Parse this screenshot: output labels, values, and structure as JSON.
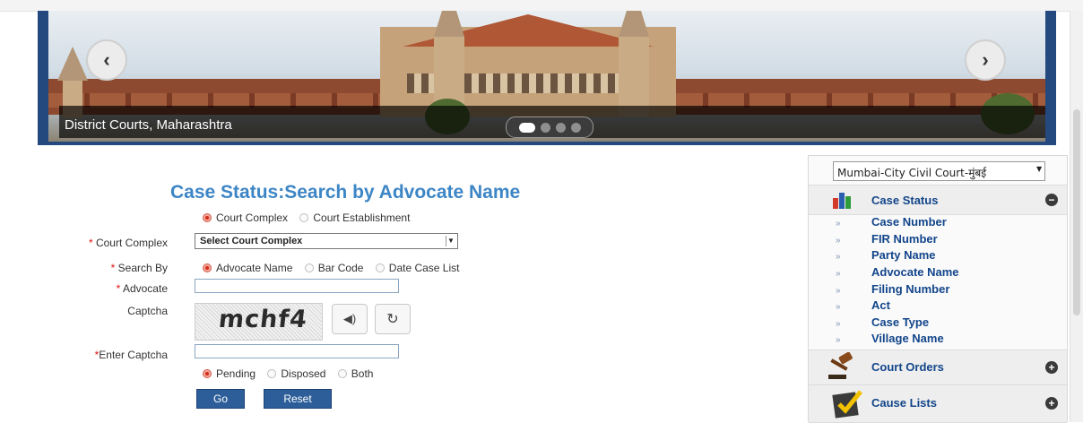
{
  "banner": {
    "caption": "District Courts, Maharashtra",
    "prev_icon": "chevron-left-icon",
    "next_icon": "chevron-right-icon",
    "slides": 4,
    "active_slide": 1
  },
  "form": {
    "title": "Case Status:Search by Advocate Name",
    "court_type_options": [
      "Court Complex",
      "Court Establishment"
    ],
    "court_type_selected": "Court Complex",
    "court_complex_label": "Court Complex",
    "court_complex_value": "Select Court Complex",
    "search_by_label": "Search By",
    "search_by_options": [
      "Advocate Name",
      "Bar Code",
      "Date Case List"
    ],
    "search_by_selected": "Advocate Name",
    "advocate_label": "Advocate",
    "advocate_value": "",
    "captcha_label": "Captcha",
    "captcha_text": "mchf4",
    "enter_captcha_label": "Enter Captcha",
    "enter_captcha_value": "",
    "status_options": [
      "Pending",
      "Disposed",
      "Both"
    ],
    "status_selected": "Pending",
    "go_label": "Go",
    "reset_label": "Reset"
  },
  "sidebar": {
    "district_select": "Mumbai-City Civil Court-मुंबई",
    "case_status": {
      "title": "Case Status",
      "expanded": true,
      "items": [
        "Case Number",
        "FIR Number",
        "Party Name",
        "Advocate Name",
        "Filing Number",
        "Act",
        "Case Type",
        "Village Name"
      ]
    },
    "court_orders": {
      "title": "Court Orders",
      "expanded": false
    },
    "cause_lists": {
      "title": "Cause Lists",
      "expanded": false
    }
  },
  "colors": {
    "title_blue": "#3d86c6",
    "link_blue": "#12458a",
    "button_blue": "#2d5e99",
    "banner_frame": "#24497e",
    "required_red": "#dd1111"
  }
}
